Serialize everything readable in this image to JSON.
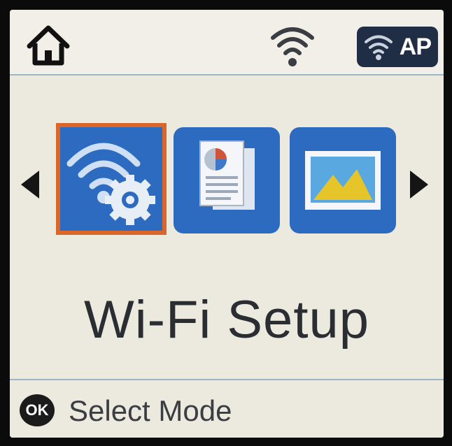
{
  "status_bar": {
    "home_icon": "home-icon",
    "wifi_icon": "wifi-signal-icon",
    "ap_label": "AP"
  },
  "carousel": {
    "items": [
      {
        "icon": "wifi-gear-icon",
        "label": "Wi-Fi Setup",
        "selected": true
      },
      {
        "icon": "document-pie-chart-icon",
        "selected": false
      },
      {
        "icon": "photo-mountain-icon",
        "selected": false
      }
    ],
    "current_label": "Wi-Fi Setup"
  },
  "footer": {
    "ok_label": "OK",
    "hint": "Select Mode"
  },
  "colors": {
    "tile_blue": "#2d6bc0",
    "selection_orange": "#d9662a",
    "screen_bg": "#ece9df",
    "ap_badge_bg": "#1f2d45"
  }
}
